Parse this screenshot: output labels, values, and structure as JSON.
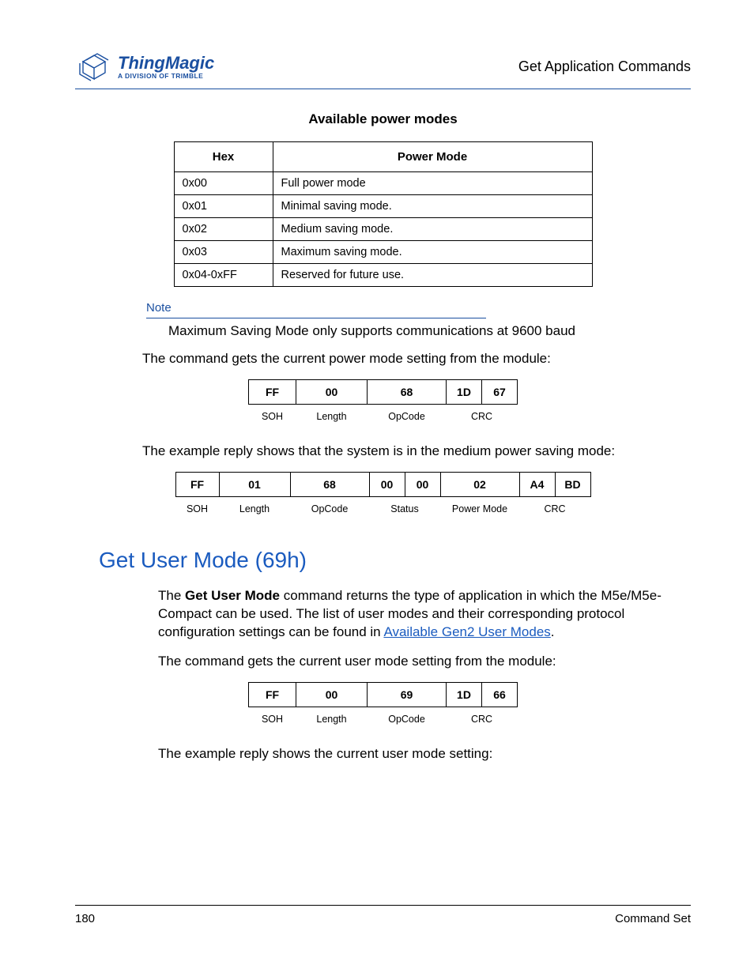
{
  "header": {
    "logo_main": "ThingMagic",
    "logo_sub": "A DIVISION OF TRIMBLE",
    "right": "Get Application Commands"
  },
  "power_modes_title": "Available power modes",
  "power_table": {
    "head_hex": "Hex",
    "head_mode": "Power Mode",
    "rows": [
      {
        "hex": "0x00",
        "mode": "Full power mode"
      },
      {
        "hex": "0x01",
        "mode": "Minimal saving mode."
      },
      {
        "hex": "0x02",
        "mode": "Medium saving mode."
      },
      {
        "hex": "0x03",
        "mode": "Maximum saving mode."
      },
      {
        "hex": "0x04-0xFF",
        "mode": "Reserved for future use."
      }
    ]
  },
  "note": {
    "label": "Note",
    "text": "Maximum Saving Mode only supports communications at 9600 baud"
  },
  "p_get_power": "The command gets the current power mode setting from the module:",
  "frame1": {
    "cells": [
      "FF",
      "00",
      "68",
      "1D",
      "67"
    ],
    "widths": [
      60,
      90,
      100,
      45,
      45
    ],
    "labels": [
      "SOH",
      "Length",
      "OpCode",
      "CRC"
    ],
    "lwidths": [
      60,
      90,
      100,
      90
    ]
  },
  "p_reply_power": "The example reply shows that the system is in the medium power saving mode:",
  "frame2": {
    "cells": [
      "FF",
      "01",
      "68",
      "00",
      "00",
      "02",
      "A4",
      "BD"
    ],
    "widths": [
      55,
      90,
      100,
      45,
      45,
      100,
      45,
      45
    ],
    "labels": [
      "SOH",
      "Length",
      "OpCode",
      "Status",
      "Power Mode",
      "CRC"
    ],
    "lwidths": [
      55,
      90,
      100,
      90,
      100,
      90
    ]
  },
  "section_title": "Get User Mode (69h)",
  "p_body_1a": "The ",
  "p_body_1b": "Get User Mode",
  "p_body_1c": " command returns the type of application in which the M5e/M5e-Compact can be used. The list of user modes and their corresponding protocol configuration settings can be found in ",
  "link_text": "Available Gen2 User Modes",
  "p_body_1d": ".",
  "p_get_user": "The command gets the current user mode setting from the module:",
  "frame3": {
    "cells": [
      "FF",
      "00",
      "69",
      "1D",
      "66"
    ],
    "widths": [
      60,
      90,
      100,
      45,
      45
    ],
    "labels": [
      "SOH",
      "Length",
      "OpCode",
      "CRC"
    ],
    "lwidths": [
      60,
      90,
      100,
      90
    ]
  },
  "p_reply_user": "The example reply shows the current user mode setting:",
  "footer": {
    "left": "180",
    "right": "Command Set"
  }
}
